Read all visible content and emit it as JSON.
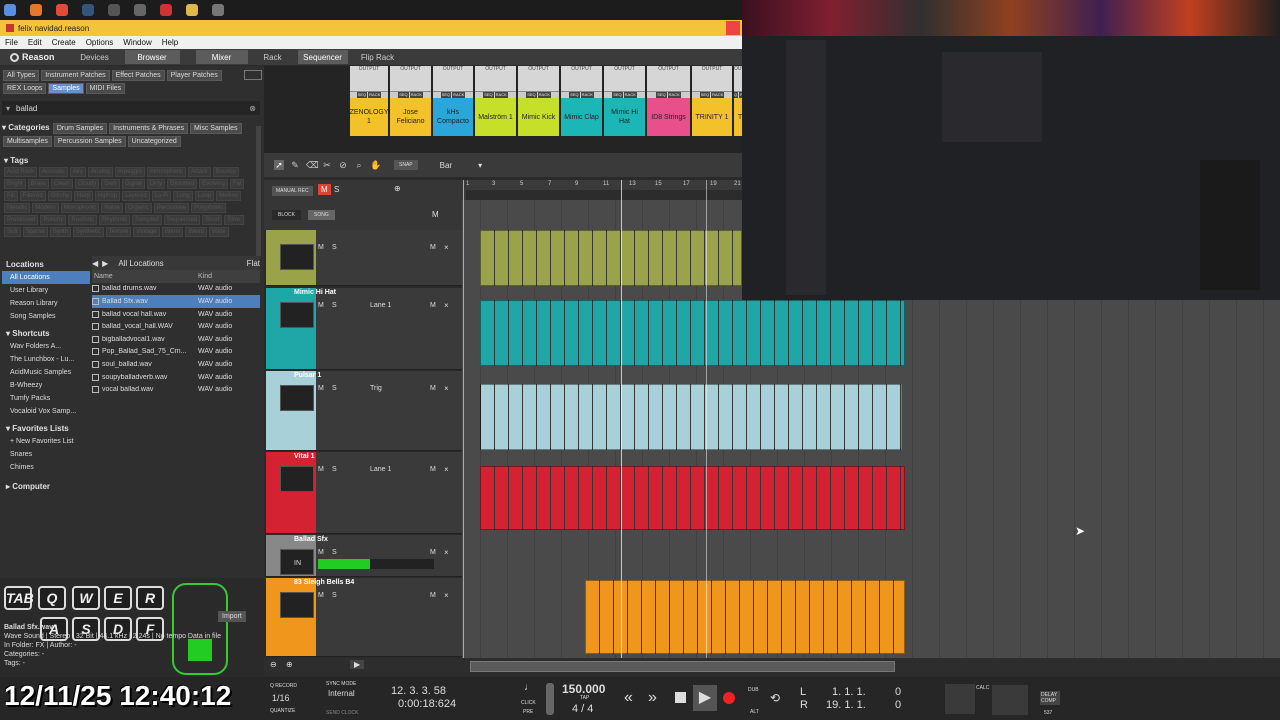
{
  "window": {
    "title": "felix navidad.reason"
  },
  "menu": [
    "File",
    "Edit",
    "Create",
    "Options",
    "Window",
    "Help"
  ],
  "toolbar": {
    "logo": "Reason",
    "items": [
      "Devices",
      "Browser",
      "Mixer",
      "Rack",
      "Sequencer",
      "Flip Rack"
    ],
    "selected": [
      "Browser",
      "Mixer",
      "Sequencer"
    ]
  },
  "browser": {
    "top_tabs": [
      "All Types",
      "Instrument Patches",
      "Effect Patches",
      "Player Patches",
      "REX Loops",
      "Samples",
      "MIDI Files"
    ],
    "selected_tab": "Samples",
    "search_value": "ballad",
    "categories_label": "Categories",
    "categories": [
      "Drum Samples",
      "Instruments & Phrases",
      "Misc Samples",
      "Multisamples",
      "Percussion Samples",
      "Uncategorized"
    ],
    "tags_label": "Tags",
    "tags": [
      "Acid Rock",
      "Acoustic",
      "Airy",
      "Analog",
      "Arpeggio",
      "Atmospheric",
      "Attack",
      "Bouncy",
      "Bright",
      "Brass",
      "Clean",
      "Cloudy",
      "Dark",
      "Digital",
      "Dirty",
      "Distorted",
      "Evolving",
      "Fat",
      "Fill",
      "Filtered",
      "Glitchy",
      "Harp",
      "Hiphop",
      "Layered",
      "Lo-Fi",
      "Long",
      "Loop",
      "Mellow",
      "Metallic",
      "Modern",
      "Monophonic",
      "Noise",
      "Organic",
      "Percussive",
      "Polyphonic",
      "Processed",
      "Punchy",
      "Realistic",
      "Rhythmic",
      "Sampled",
      "Sequenced",
      "Short",
      "Slow",
      "Soft",
      "Sparse",
      "Synth",
      "Synthetic",
      "Texture",
      "Vintage",
      "Warm",
      "Weird",
      "Wide"
    ],
    "locations_label": "Locations",
    "locations": [
      "All Locations",
      "User Library",
      "Reason Library",
      "Song Samples"
    ],
    "shortcuts_label": "Shortcuts",
    "shortcuts": [
      "Wav Folders A...",
      "The Lunchbox - Lu...",
      "AcidMusic Samples",
      "B-Wheezy",
      "Tumfy Packs",
      "Vocaloid Vox Samp..."
    ],
    "favorites_label": "Favorites Lists",
    "favorites_new": "+ New Favorites List",
    "favorites": [
      "Snares",
      "Chimes"
    ],
    "computer": "Computer",
    "nav": {
      "location": "All Locations",
      "view": "Flat"
    },
    "columns": {
      "name": "Name",
      "kind": "Kind"
    },
    "files": [
      {
        "name": "ballad drums.wav",
        "kind": "WAV audio"
      },
      {
        "name": "Ballad Sfx.wav",
        "kind": "WAV audio"
      },
      {
        "name": "ballad vocal hall.wav",
        "kind": "WAV audio"
      },
      {
        "name": "ballad_vocal_hall.WAV",
        "kind": "WAV audio"
      },
      {
        "name": "bigballadvocal1.wav",
        "kind": "WAV audio"
      },
      {
        "name": "Pop_Ballad_Sad_75_Cm...",
        "kind": "WAV audio"
      },
      {
        "name": "soul_ballad.wav",
        "kind": "WAV audio"
      },
      {
        "name": "soupyballadverb.wav",
        "kind": "WAV audio"
      },
      {
        "name": "vocal ballad.wav",
        "kind": "WAV audio"
      }
    ],
    "selected_file": "Ballad Sfx.wav",
    "preview": {
      "filename": "Ballad Sfx.wav",
      "info": "Wave Sound | Stereo | 32 Bit | 44.1 kHz | 2.24s | No tempo Data in file",
      "folder": "In Folder: FX | Author: -",
      "categories": "Categories: -",
      "tags": "Tags: -",
      "import": "Import"
    }
  },
  "rack": {
    "devices": [
      {
        "name": "ZENOLOGY 1",
        "color": "#f3c12a"
      },
      {
        "name": "Jose Feliciano",
        "color": "#f3c12a"
      },
      {
        "name": "kHs Compacto",
        "color": "#2aa7d8"
      },
      {
        "name": "Malström 1",
        "color": "#c6e02a"
      },
      {
        "name": "Mimic Kick",
        "color": "#c6e02a"
      },
      {
        "name": "Mimic Clap",
        "color": "#1cb6b6"
      },
      {
        "name": "Mimic Hi Hat",
        "color": "#1cb6b6"
      },
      {
        "name": "ID8 Strings",
        "color": "#e8508c"
      },
      {
        "name": "TRINITY 1",
        "color": "#f3c12a"
      },
      {
        "name": "T",
        "color": "#f3c12a"
      }
    ],
    "output_label": "OUTPUT",
    "seq_label": "SEQ",
    "rack_label": "RACK"
  },
  "sequencer": {
    "snap": "SNAP",
    "snap_value": "Bar",
    "manual_rec": "MANUAL REC",
    "block": "BLOCK",
    "song": "SONG",
    "ruler_ticks": [
      "1",
      "3",
      "5",
      "7",
      "9",
      "11",
      "13",
      "15",
      "17",
      "19",
      "21"
    ],
    "tracks": [
      {
        "name": "",
        "lane": "",
        "color": "#9aa24a"
      },
      {
        "name": "Mimic Hi Hat",
        "lane": "Lane 1",
        "color": "#1fa7a7"
      },
      {
        "name": "Pulsar 1",
        "lane": "Trig",
        "color": "#a8d0d8"
      },
      {
        "name": "Vital 1",
        "lane": "Lane 1",
        "color": "#d42232"
      },
      {
        "name": "Ballad Sfx",
        "lane": "",
        "color": "#888"
      },
      {
        "name": "83 Sleigh Bells B4",
        "lane": "",
        "color": "#f0961c"
      }
    ],
    "m": "M",
    "s": "S",
    "in_label": "IN"
  },
  "transport": {
    "q_record": "Q RECORD",
    "quantize_value": "1/16",
    "quantize_label": "QUANTIZE",
    "sync_mode_label": "SYNC MODE",
    "sync_mode": "Internal",
    "send_clock": "SEND CLOCK",
    "position": "12. 3. 3. 58",
    "time": "0:00:18:624",
    "click": "CLICK",
    "pre": "PRE",
    "tempo": "150.000",
    "tap": "TAP",
    "signature": "4 / 4",
    "dub": "DUB",
    "alt": "ALT",
    "loop_l_label": "L",
    "loop_r_label": "R",
    "loop_l": "1. 1. 1.",
    "loop_l2": "0",
    "loop_r": "19. 1. 1.",
    "loop_r2": "0",
    "calc": "CALC",
    "delay_comp": "DELAY COMP",
    "delay_val": "537"
  },
  "clock_overlay": "12/11/25 12:40:12",
  "keys_overlay": [
    "TAB",
    "Q",
    "W",
    "E",
    "R",
    "A",
    "S",
    "D",
    "F"
  ],
  "colors": {
    "accent_blue": "#4d7ebd",
    "yellow_bar": "#f2c43a",
    "arrange_bg": "#4a4a4a"
  }
}
